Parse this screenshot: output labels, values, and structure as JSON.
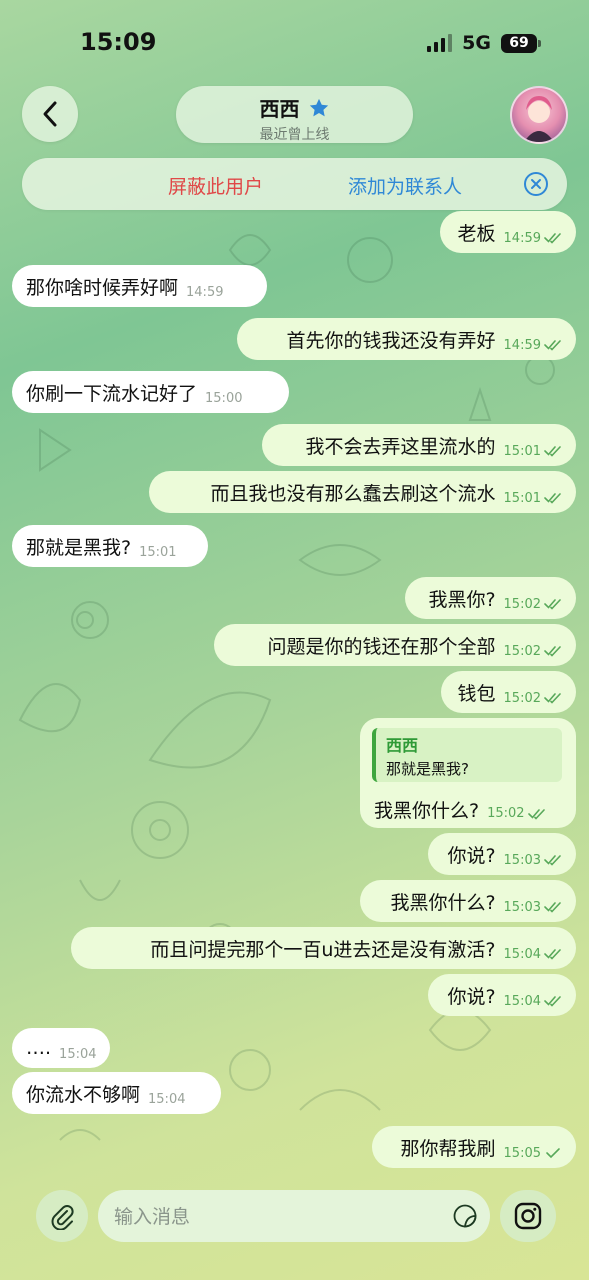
{
  "status_bar": {
    "time": "15:09",
    "network": "5G",
    "battery": "69"
  },
  "header": {
    "back_icon": "chevron-left-icon",
    "name": "西西",
    "status": "最近曾上线",
    "verified_icon": "star-icon"
  },
  "banner": {
    "block_label": "屏蔽此用户",
    "add_label": "添加为联系人",
    "close_icon": "close-circle-icon"
  },
  "messages": [
    {
      "dir": "out",
      "text": "老板",
      "time": "14:59",
      "read": true
    },
    {
      "dir": "in",
      "text": "那你啥时候弄好啊",
      "time": "14:59"
    },
    {
      "dir": "out",
      "text": "首先你的钱我还没有弄好",
      "time": "14:59",
      "read": true
    },
    {
      "dir": "in",
      "text": "你刷一下流水记好了",
      "time": "15:00"
    },
    {
      "dir": "out",
      "text": "我不会去弄这里流水的",
      "time": "15:01",
      "read": true
    },
    {
      "dir": "out",
      "text": "而且我也没有那么蠢去刷这个流水",
      "time": "15:01",
      "read": true
    },
    {
      "dir": "in",
      "text": "那就是黑我?",
      "time": "15:01"
    },
    {
      "dir": "out",
      "text": "我黑你?",
      "time": "15:02",
      "read": true
    },
    {
      "dir": "out",
      "text": "问题是你的钱还在那个全部",
      "time": "15:02",
      "read": true
    },
    {
      "dir": "out",
      "text": "钱包",
      "time": "15:02",
      "read": true
    },
    {
      "dir": "out",
      "text": "我黑你什么?",
      "time": "15:02",
      "read": true,
      "reply_to": {
        "name": "西西",
        "text": "那就是黑我?"
      }
    },
    {
      "dir": "out",
      "text": "你说?",
      "time": "15:03",
      "read": true
    },
    {
      "dir": "out",
      "text": "我黑你什么?",
      "time": "15:03",
      "read": true
    },
    {
      "dir": "out",
      "text": "而且问提完那个一百u进去还是没有激活?",
      "time": "15:04",
      "read": true
    },
    {
      "dir": "out",
      "text": "你说?",
      "time": "15:04",
      "read": true
    },
    {
      "dir": "in",
      "text": "….",
      "time": "15:04"
    },
    {
      "dir": "in",
      "text": "你流水不够啊",
      "time": "15:04"
    },
    {
      "dir": "out",
      "text": "那你帮我刷",
      "time": "15:05",
      "read": false
    }
  ],
  "composer": {
    "placeholder": "输入消息",
    "attach_icon": "paperclip-icon",
    "sticker_icon": "sticker-icon",
    "camera_icon": "instagram-camera-icon"
  }
}
